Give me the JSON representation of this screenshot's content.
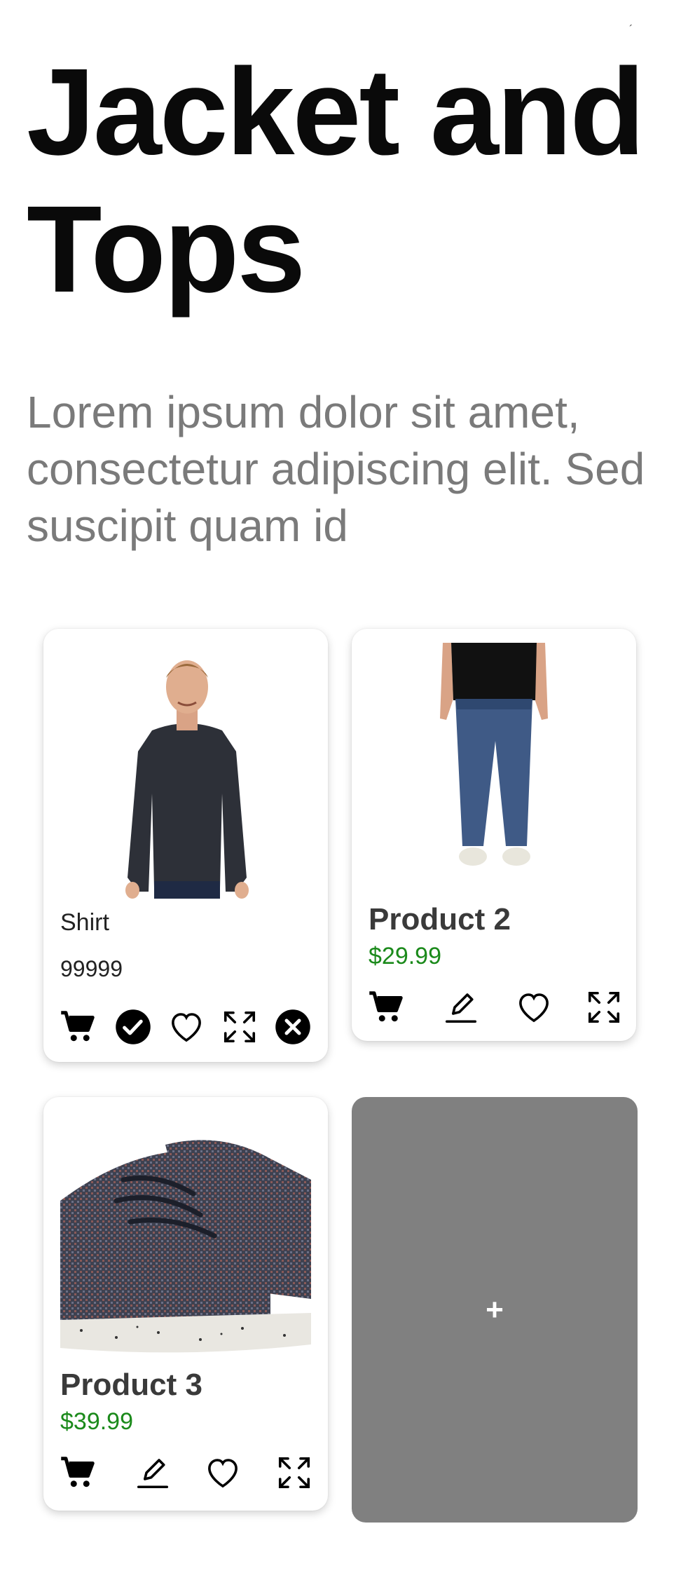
{
  "status_bar": {
    "mark": "´"
  },
  "header": {
    "title": "Jacket and Tops",
    "subtitle": "Lorem ipsum dolor sit amet, consectetur adipiscing elit. Sed suscipit quam id"
  },
  "products": [
    {
      "name": "Shirt",
      "price": "99999",
      "actions": [
        "cart-icon",
        "check-circle-icon",
        "heart-icon",
        "expand-icon",
        "close-circle-icon"
      ]
    },
    {
      "name": "Product 2",
      "price": "$29.99",
      "actions": [
        "cart-icon",
        "pencil-icon",
        "heart-icon",
        "expand-icon"
      ]
    },
    {
      "name": "Product 3",
      "price": "$39.99",
      "actions": [
        "cart-icon",
        "pencil-icon",
        "heart-icon",
        "expand-icon"
      ]
    }
  ],
  "add_tile": {
    "label": "+"
  },
  "colors": {
    "price_green": "#1b8a1b",
    "add_tile_bg": "#808080",
    "subtitle_gray": "#7a7a7a"
  }
}
